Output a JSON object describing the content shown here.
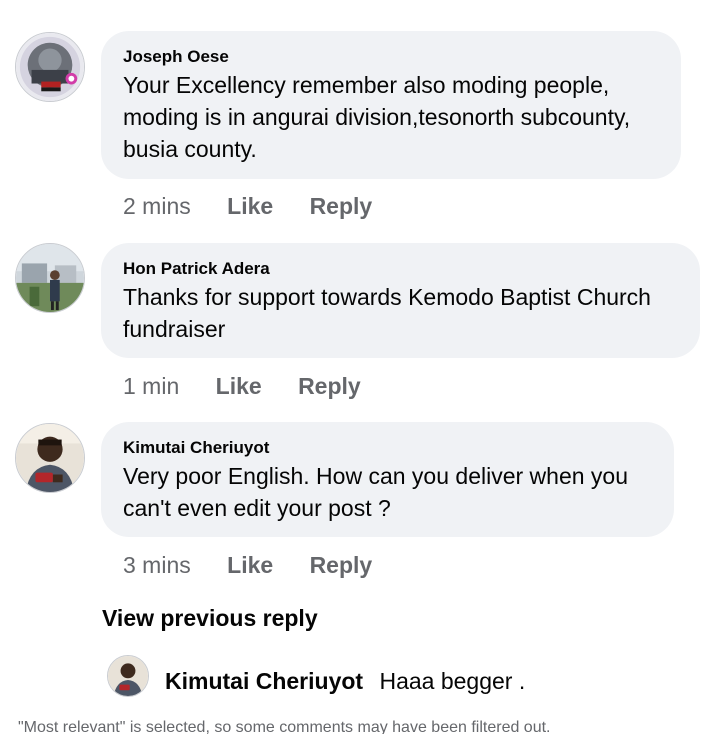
{
  "comments": [
    {
      "author": "Joseph Oese",
      "text": "Your Excellency remember also moding people, moding is in angurai division,tesonorth subcounty, busia county.",
      "time": "2 mins",
      "like_label": "Like",
      "reply_label": "Reply"
    },
    {
      "author": "Hon Patrick Adera",
      "text": "Thanks for support towards Kemodo Baptist Church fundraiser",
      "time": "1 min",
      "like_label": "Like",
      "reply_label": "Reply"
    },
    {
      "author": "Kimutai Cheriuyot",
      "text": "Very poor English.  How can you deliver when you can't even edit your post ?",
      "time": "3 mins",
      "like_label": "Like",
      "reply_label": "Reply"
    }
  ],
  "view_previous_reply": "View previous reply",
  "reply": {
    "author": "Kimutai Cheriuyot",
    "text": "Haaa begger ."
  },
  "footer_note": "\"Most relevant\" is selected, so some comments may have been filtered out.",
  "colors": {
    "bubble_bg": "#f0f2f5",
    "meta_text": "#65676b",
    "primary_text": "#050505"
  },
  "icons": [
    "avatar-joseph-oese",
    "avatar-hon-patrick-adera",
    "avatar-kimutai-cheriuyot"
  ]
}
